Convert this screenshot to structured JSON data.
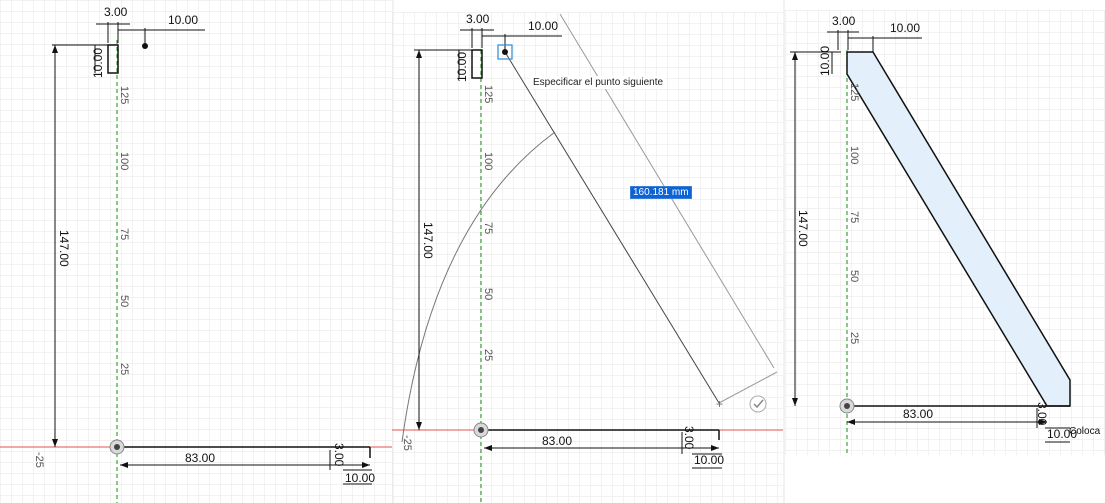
{
  "panel1": {
    "dims": {
      "width_top": "3.00",
      "offset_top": "10.00",
      "height_left": "10.00",
      "height_total": "147.00",
      "base_length": "83.00",
      "thick_right": "3.00",
      "end_width": "10.00"
    },
    "ruler": [
      "125",
      "100",
      "75",
      "50",
      "25",
      "-25"
    ]
  },
  "panel2": {
    "dims": {
      "width_top": "3.00",
      "offset_top": "10.00",
      "height_left": "10.00",
      "height_total": "147.00",
      "base_length": "83.00",
      "thick_right": "3.00",
      "end_width": "10.00"
    },
    "ruler": [
      "125",
      "100",
      "75",
      "50",
      "25",
      "-25"
    ],
    "tooltip": "Especificar el punto siguiente",
    "length_input": "160.181 mm"
  },
  "panel3": {
    "dims": {
      "width_top": "3.00",
      "offset_top": "10.00",
      "height_left": "10.00",
      "height_total": "147.00",
      "base_length": "83.00",
      "thick_right": "3.00",
      "end_width": "10.00"
    },
    "ruler": [
      "125",
      "100",
      "75",
      "50",
      "25"
    ],
    "cut_text": "Coloca"
  },
  "colors": {
    "grid": "#e6e6e6",
    "axis_green": "#3aa53a",
    "axis_red": "#e05050",
    "fill_blue": "#e3f0fb",
    "highlight": "#0a64d8"
  },
  "icons": [
    "origin-marker-icon",
    "confirm-check-icon",
    "snap-point-icon"
  ]
}
